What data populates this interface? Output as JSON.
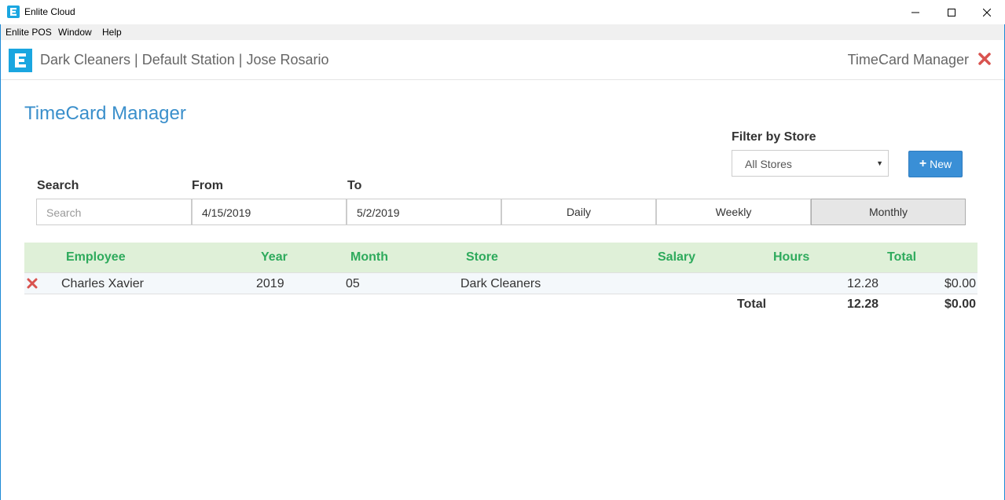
{
  "window": {
    "title": "Enlite Cloud",
    "app_icon": "enlite-icon"
  },
  "menu": {
    "items": [
      "Enlite POS",
      "Window",
      "Help"
    ]
  },
  "header": {
    "info": "Dark Cleaners | Default Station | Jose Rosario",
    "module": "TimeCard Manager"
  },
  "page": {
    "title": "TimeCard Manager"
  },
  "filter": {
    "label": "Filter by Store",
    "selected": "All Stores",
    "new_label": "New"
  },
  "search": {
    "label": "Search",
    "placeholder": "Search",
    "value": ""
  },
  "from": {
    "label": "From",
    "value": "4/15/2019"
  },
  "to": {
    "label": "To",
    "value": "5/2/2019"
  },
  "periods": {
    "daily": "Daily",
    "weekly": "Weekly",
    "monthly": "Monthly",
    "active": "Monthly"
  },
  "table": {
    "headers": {
      "employee": "Employee",
      "year": "Year",
      "month": "Month",
      "store": "Store",
      "salary": "Salary",
      "hours": "Hours",
      "total": "Total"
    },
    "rows": [
      {
        "employee": "Charles Xavier",
        "year": "2019",
        "month": "05",
        "store": "Dark Cleaners",
        "salary": "",
        "hours": "12.28",
        "total": "$0.00"
      }
    ],
    "footer": {
      "label": "Total",
      "hours": "12.28",
      "total": "$0.00"
    }
  },
  "colors": {
    "accent": "#3a8fcb",
    "brand": "#1aa6e0",
    "header_row": "#dff0d8",
    "header_text": "#2eaa5c",
    "delete": "#d9534f"
  }
}
